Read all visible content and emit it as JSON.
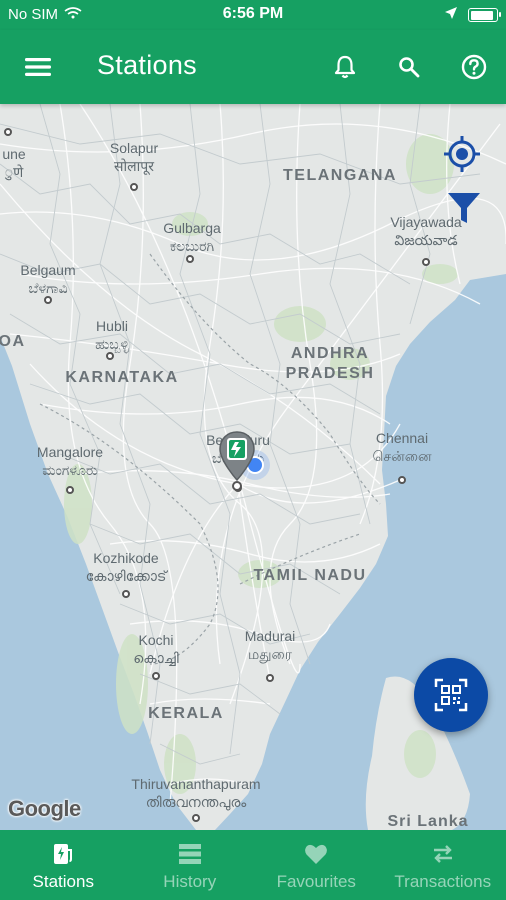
{
  "status_bar": {
    "carrier": "No SIM",
    "time": "6:56 PM"
  },
  "header": {
    "title": "Stations"
  },
  "map": {
    "labels": {
      "solapur": "Solapur",
      "solapur_native": "सोलापूर",
      "telangana": "TELANGANA",
      "gulbarga": "Gulbarga",
      "gulbarga_native": "ಕಲಬುರಗಿ",
      "vijayawada": "Vijayawada",
      "vijayawada_native": "విజయవాడ",
      "belgaum": "Belgaum",
      "belgaum_native": "ಬೆಳಗಾವಿ",
      "hubli": "Hubli",
      "hubli_native": "ಹುಬ್ಬಳ್ಳಿ",
      "karnataka": "KARNATAKA",
      "andhra_1": "ANDHRA",
      "andhra_2": "PRADESH",
      "bengaluru": "Bengaluru",
      "bengaluru_native": "ಬೆಂಗಳೂರು",
      "chennai": "Chennai",
      "chennai_native": "சென்னை",
      "mangalore": "Mangalore",
      "mangalore_native": "ಮಂಗಳೂರು",
      "kozhikode": "Kozhikode",
      "kozhikode_native": "കോഴിക്കോട്",
      "tamil_nadu": "TAMIL NADU",
      "kochi": "Kochi",
      "kochi_native": "കൊച്ചി",
      "madurai": "Madurai",
      "madurai_native": "மதுரை",
      "kerala": "KERALA",
      "thiruvananthapuram": "Thiruvananthapuram",
      "thiruvananthapuram_native": "തിരുവനന്തപുരം",
      "sri_lanka": "Sri Lanka",
      "pune_partial": "une",
      "pune_native_partial": "ुणे",
      "goa_partial": "OA"
    },
    "attribution": "Google"
  },
  "bottom_nav": [
    {
      "label": "Stations",
      "icon": "charging-station-icon",
      "active": true
    },
    {
      "label": "History",
      "icon": "history-icon",
      "active": false
    },
    {
      "label": "Favourites",
      "icon": "heart-icon",
      "active": false
    },
    {
      "label": "Transactions",
      "icon": "transactions-icon",
      "active": false
    }
  ],
  "colors": {
    "primary": "#16a062",
    "fab": "#0c4aa6",
    "accent_blue": "#1b4fa8",
    "sea": "#aac8de",
    "land": "#e4e7e6"
  }
}
